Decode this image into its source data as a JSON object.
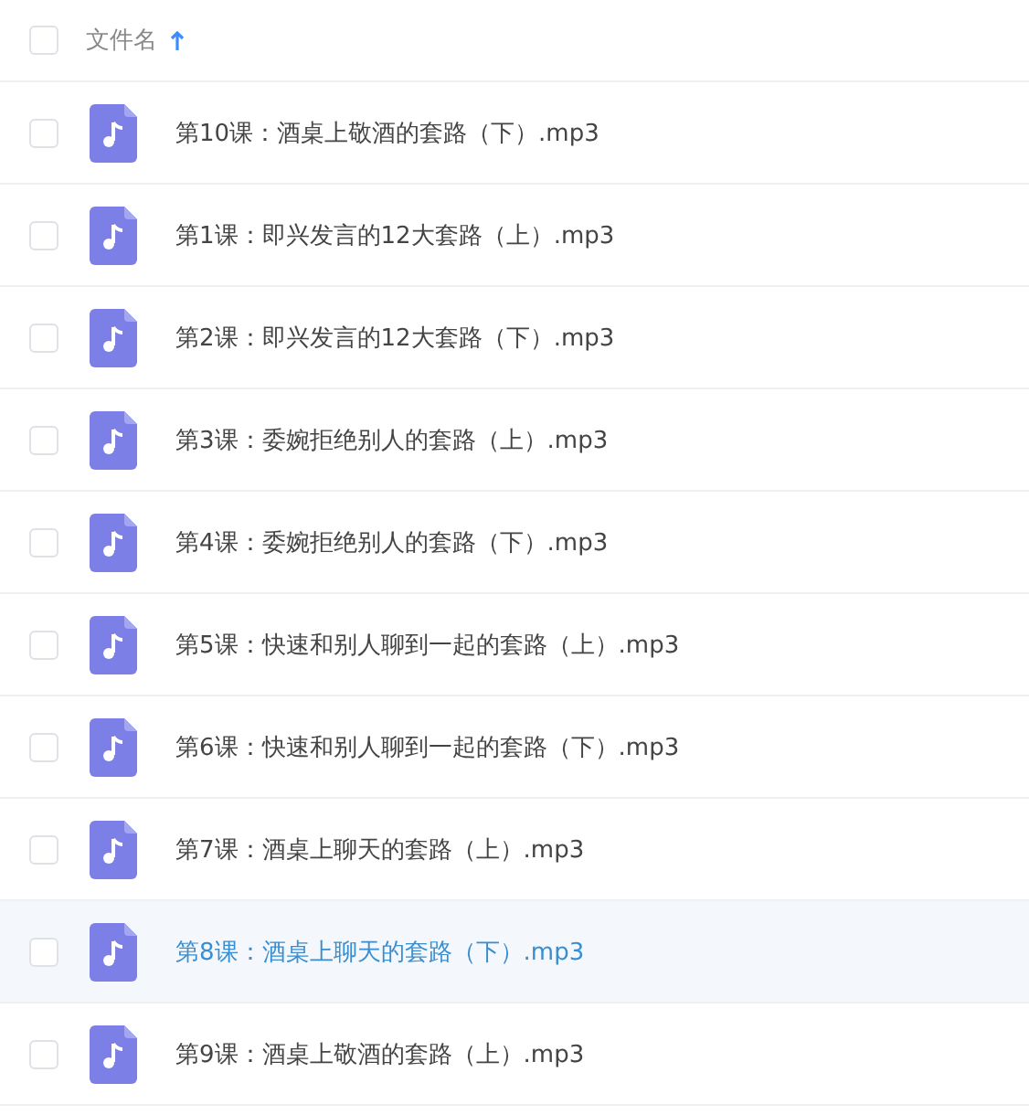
{
  "header": {
    "checked": false,
    "column_label": "文件名",
    "sort_ascending": true
  },
  "files": [
    {
      "name": "第10课：酒桌上敬酒的套路（下）.mp3",
      "checked": false,
      "highlighted": false
    },
    {
      "name": "第1课：即兴发言的12大套路（上）.mp3",
      "checked": false,
      "highlighted": false
    },
    {
      "name": "第2课：即兴发言的12大套路（下）.mp3",
      "checked": false,
      "highlighted": false
    },
    {
      "name": "第3课：委婉拒绝别人的套路（上）.mp3",
      "checked": false,
      "highlighted": false
    },
    {
      "name": "第4课：委婉拒绝别人的套路（下）.mp3",
      "checked": false,
      "highlighted": false
    },
    {
      "name": "第5课：快速和别人聊到一起的套路（上）.mp3",
      "checked": false,
      "highlighted": false
    },
    {
      "name": "第6课：快速和别人聊到一起的套路（下）.mp3",
      "checked": false,
      "highlighted": false
    },
    {
      "name": "第7课：酒桌上聊天的套路（上）.mp3",
      "checked": false,
      "highlighted": false
    },
    {
      "name": "第8课：酒桌上聊天的套路（下）.mp3",
      "checked": false,
      "highlighted": true
    },
    {
      "name": "第9课：酒桌上敬酒的套路（上）.mp3",
      "checked": false,
      "highlighted": false
    }
  ]
}
